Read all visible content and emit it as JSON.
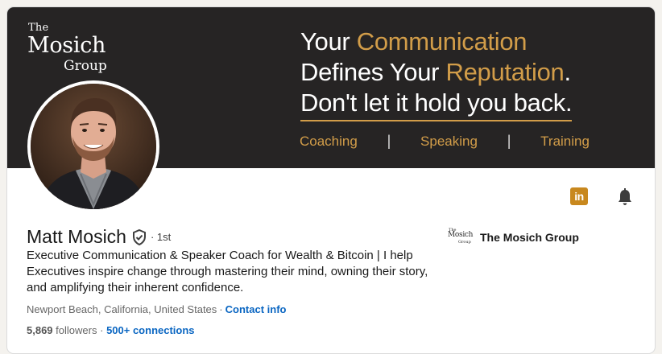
{
  "banner": {
    "logo": {
      "the": "The",
      "name": "Mosich",
      "group": "Group"
    },
    "headline": {
      "line1_a": "Your ",
      "line1_b": "Communication",
      "line2_a": "Defines Your ",
      "line2_b": "Reputation",
      "line2_c": ".",
      "line3": "Don't let it hold you back."
    },
    "services": [
      "Coaching",
      "Speaking",
      "Training"
    ],
    "separator": "|",
    "colors": {
      "background": "#262424",
      "accent": "#d29d49"
    }
  },
  "profile": {
    "name": "Matt Mosich",
    "degree": "· 1st",
    "headline": "Executive Communication & Speaker Coach for Wealth & Bitcoin | I help Executives inspire change through mastering their mind, owning their story, and amplifying their inherent confidence.",
    "location": "Newport Beach, California, United States",
    "location_sep": "·",
    "contact_label": "Contact info",
    "followers_count": "5,869",
    "followers_label": "followers",
    "connections_sep": "·",
    "connections": "500+ connections"
  },
  "actions": {
    "linkedin_icon": "linkedin-icon",
    "linkedin_text": "in",
    "bell_icon": "bell-icon"
  },
  "company": {
    "logo": {
      "the": "The",
      "name": "Mosich",
      "group": "Group"
    },
    "name": "The Mosich Group"
  },
  "icons": {
    "verified": "shield-check-icon"
  }
}
